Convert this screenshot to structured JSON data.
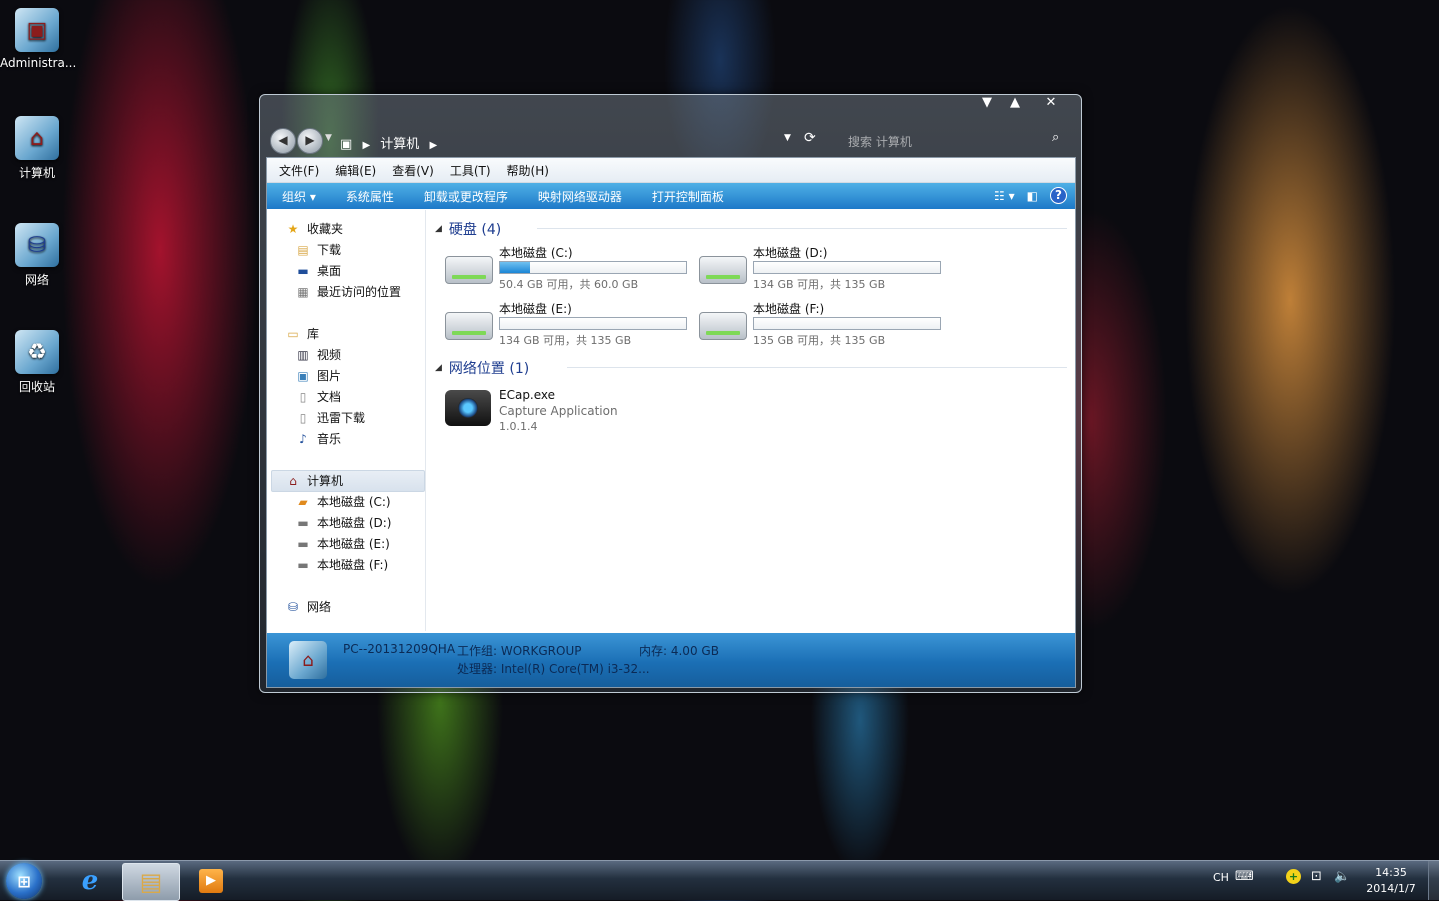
{
  "desktop": {
    "icons": [
      {
        "label": "Administra..."
      },
      {
        "label": "计算机"
      },
      {
        "label": "网络"
      },
      {
        "label": "回收站"
      }
    ]
  },
  "window": {
    "breadcrumb": [
      "计算机"
    ],
    "search_placeholder": "搜索 计算机",
    "menu": [
      "文件(F)",
      "编辑(E)",
      "查看(V)",
      "工具(T)",
      "帮助(H)"
    ],
    "toolbar": [
      "组织 ▾",
      "系统属性",
      "卸载或更改程序",
      "映射网络驱动器",
      "打开控制面板"
    ],
    "help_glyph": "?",
    "sidebar": {
      "favorites": {
        "title": "收藏夹",
        "items": [
          "下载",
          "桌面",
          "最近访问的位置"
        ]
      },
      "libraries": {
        "title": "库",
        "items": [
          "视频",
          "图片",
          "文档",
          "迅雷下载",
          "音乐"
        ]
      },
      "computer": {
        "title": "计算机",
        "items": [
          "本地磁盘 (C:)",
          "本地磁盘 (D:)",
          "本地磁盘 (E:)",
          "本地磁盘 (F:)"
        ]
      },
      "network": {
        "title": "网络"
      }
    },
    "content": {
      "hard_disks_header": "硬盘 (4)",
      "drives": [
        {
          "name": "本地磁盘 (C:)",
          "info": "50.4 GB 可用，共 60.0 GB",
          "used_fraction": 0.16
        },
        {
          "name": "本地磁盘 (D:)",
          "info": "134 GB 可用，共 135 GB",
          "used_fraction": 0.0
        },
        {
          "name": "本地磁盘 (E:)",
          "info": "134 GB 可用，共 135 GB",
          "used_fraction": 0.0
        },
        {
          "name": "本地磁盘 (F:)",
          "info": "135 GB 可用，共 135 GB",
          "used_fraction": 0.0
        }
      ],
      "network_header": "网络位置 (1)",
      "network_item": {
        "name": "ECap.exe",
        "desc": "Capture Application",
        "version": "1.0.1.4"
      }
    },
    "details": {
      "pc_name": "PC--20131209QHA",
      "workgroup": "工作组: WORKGROUP",
      "memory": "内存: 4.00 GB",
      "processor": "处理器: Intel(R) Core(TM) i3-32..."
    }
  },
  "taskbar": {
    "lang": "CH",
    "time": "14:35",
    "date": "2014/1/7"
  }
}
